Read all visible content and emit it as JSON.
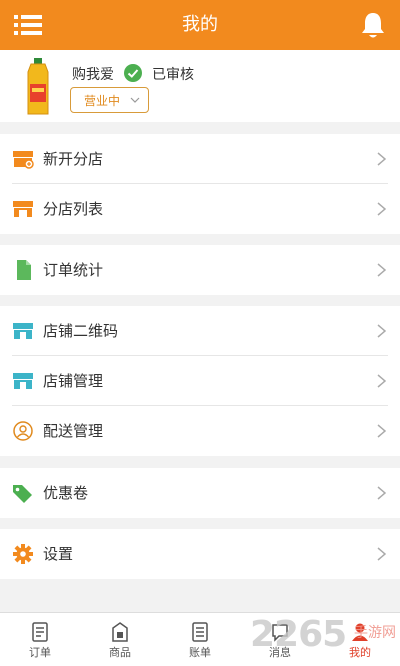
{
  "header": {
    "title": "我的",
    "menu_icon": "list-menu-icon",
    "bell_icon": "bell-icon"
  },
  "profile": {
    "store_name": "购我爱",
    "verified_label": "已审核",
    "status_value": "营业中"
  },
  "menu": {
    "group1": [
      {
        "label": "新开分店",
        "icon": "new-branch-store-icon"
      },
      {
        "label": "分店列表",
        "icon": "branch-list-store-icon"
      }
    ],
    "group2": [
      {
        "label": "订单统计",
        "icon": "document-icon"
      }
    ],
    "group3": [
      {
        "label": "店铺二维码",
        "icon": "store-qr-icon"
      },
      {
        "label": "店铺管理",
        "icon": "store-manage-icon"
      },
      {
        "label": "配送管理",
        "icon": "delivery-person-icon"
      }
    ],
    "group4": [
      {
        "label": "优惠卷",
        "icon": "tag-icon"
      }
    ],
    "group5": [
      {
        "label": "设置",
        "icon": "gear-icon"
      }
    ]
  },
  "tabbar": [
    {
      "label": "订单",
      "icon": "order-icon"
    },
    {
      "label": "商品",
      "icon": "goods-icon"
    },
    {
      "label": "账单",
      "icon": "bill-icon"
    },
    {
      "label": "消息",
      "icon": "message-icon"
    },
    {
      "label": "我的",
      "icon": "profile-icon",
      "active": true
    }
  ],
  "watermark": {
    "digits": "2265",
    "text": "手游网"
  },
  "colors": {
    "brand": "#f28a1e",
    "active_tab": "#e0402a",
    "verified": "#4caf50",
    "teal": "#3cb4c8"
  }
}
